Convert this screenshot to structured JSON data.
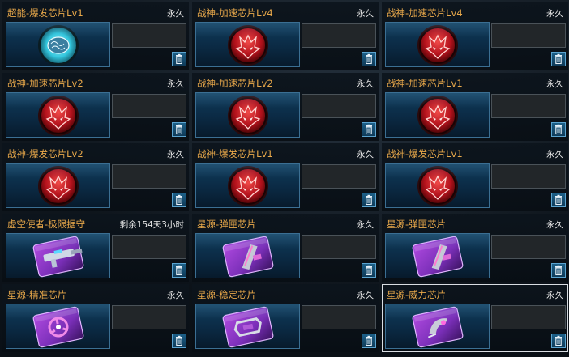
{
  "slots": [
    {
      "name": "超能-爆发芯片Lv1",
      "duration": "永久",
      "icon": "brain-energy-chip-icon",
      "selected": false
    },
    {
      "name": "战神-加速芯片Lv4",
      "duration": "永久",
      "icon": "red-demon-chip-icon",
      "selected": false
    },
    {
      "name": "战神-加速芯片Lv4",
      "duration": "永久",
      "icon": "red-demon-chip-icon",
      "selected": false
    },
    {
      "name": "战神-加速芯片Lv2",
      "duration": "永久",
      "icon": "red-demon-chip-icon",
      "selected": false
    },
    {
      "name": "战神-加速芯片Lv2",
      "duration": "永久",
      "icon": "red-demon-chip-icon",
      "selected": false
    },
    {
      "name": "战神-加速芯片Lv1",
      "duration": "永久",
      "icon": "red-demon-chip-icon",
      "selected": false
    },
    {
      "name": "战神-爆发芯片Lv2",
      "duration": "永久",
      "icon": "red-demon-chip-icon",
      "selected": false
    },
    {
      "name": "战神-爆发芯片Lv1",
      "duration": "永久",
      "icon": "red-demon-chip-icon",
      "selected": false
    },
    {
      "name": "战神-爆发芯片Lv1",
      "duration": "永久",
      "icon": "red-demon-chip-icon",
      "selected": false
    },
    {
      "name": "虚空使者-极限据守",
      "duration": "剩余154天3小时",
      "icon": "purple-gun-card-icon",
      "selected": false
    },
    {
      "name": "星源-弹匣芯片",
      "duration": "永久",
      "icon": "purple-magazine-card-icon",
      "selected": false
    },
    {
      "name": "星源-弹匣芯片",
      "duration": "永久",
      "icon": "purple-magazine-card-icon",
      "selected": false
    },
    {
      "name": "星源-精准芯片",
      "duration": "永久",
      "icon": "purple-crosshair-card-icon",
      "selected": false
    },
    {
      "name": "星源-稳定芯片",
      "duration": "永久",
      "icon": "purple-stabilizer-card-icon",
      "selected": false
    },
    {
      "name": "星源-威力芯片",
      "duration": "永久",
      "icon": "purple-power-card-icon",
      "selected": true
    }
  ],
  "colors": {
    "name_text": "#e8a84a",
    "duration_text": "#e6e6e6",
    "icon_bg": "#0f3c5c",
    "red_core": "#b4121c",
    "purple_card": "#7a2fb8",
    "cyan_glow": "#35d0e8"
  }
}
